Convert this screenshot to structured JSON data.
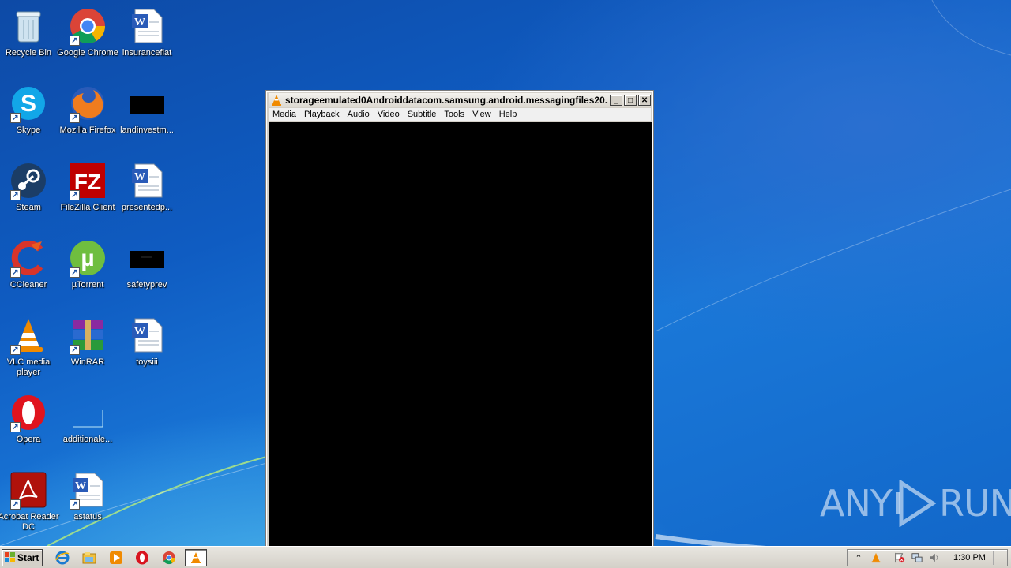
{
  "desktop": {
    "icons": [
      {
        "label": "Recycle Bin",
        "icon": "recycle-bin-icon"
      },
      {
        "label": "Google Chrome",
        "icon": "chrome-icon"
      },
      {
        "label": "insuranceflat",
        "icon": "word-document-icon"
      },
      {
        "label": "Skype",
        "icon": "skype-icon"
      },
      {
        "label": "Mozilla Firefox",
        "icon": "firefox-icon"
      },
      {
        "label": "landinvestm...",
        "icon": "black-thumbnail-icon"
      },
      {
        "label": "Steam",
        "icon": "steam-icon"
      },
      {
        "label": "FileZilla Client",
        "icon": "filezilla-icon"
      },
      {
        "label": "presentedp...",
        "icon": "word-document-icon"
      },
      {
        "label": "CCleaner",
        "icon": "ccleaner-icon"
      },
      {
        "label": "µTorrent",
        "icon": "utorrent-icon"
      },
      {
        "label": "safetyprev",
        "icon": "black-thumbnail-icon"
      },
      {
        "label": "VLC media player",
        "icon": "vlc-icon"
      },
      {
        "label": "WinRAR",
        "icon": "winrar-icon"
      },
      {
        "label": "toysiii",
        "icon": "word-document-icon"
      },
      {
        "label": "Opera",
        "icon": "opera-icon"
      },
      {
        "label": "additionale...",
        "icon": "blank-file-icon"
      },
      {
        "label": "Acrobat Reader DC",
        "icon": "acrobat-icon"
      },
      {
        "label": "astatus",
        "icon": "word-document-icon"
      }
    ]
  },
  "vlc": {
    "title": "storageemulated0Androiddatacom.samsung.android.messagingfiles20...",
    "menu": [
      "Media",
      "Playback",
      "Audio",
      "Video",
      "Subtitle",
      "Tools",
      "View",
      "Help"
    ],
    "buttons": {
      "minimize": "_",
      "maximize": "□",
      "close": "✕"
    }
  },
  "watermark": {
    "left": "ANY",
    "right": "RUN"
  },
  "taskbar": {
    "start_label": "Start",
    "quick_launch": [
      "ie-icon",
      "explorer-icon",
      "media-player-icon",
      "opera-icon",
      "chrome-icon",
      "vlc-icon"
    ],
    "clock": "1:30 PM"
  },
  "colors": {
    "desktop": "#1565c8",
    "taskbar": "#d4d0c8",
    "vlc_orange": "#f08a00"
  }
}
